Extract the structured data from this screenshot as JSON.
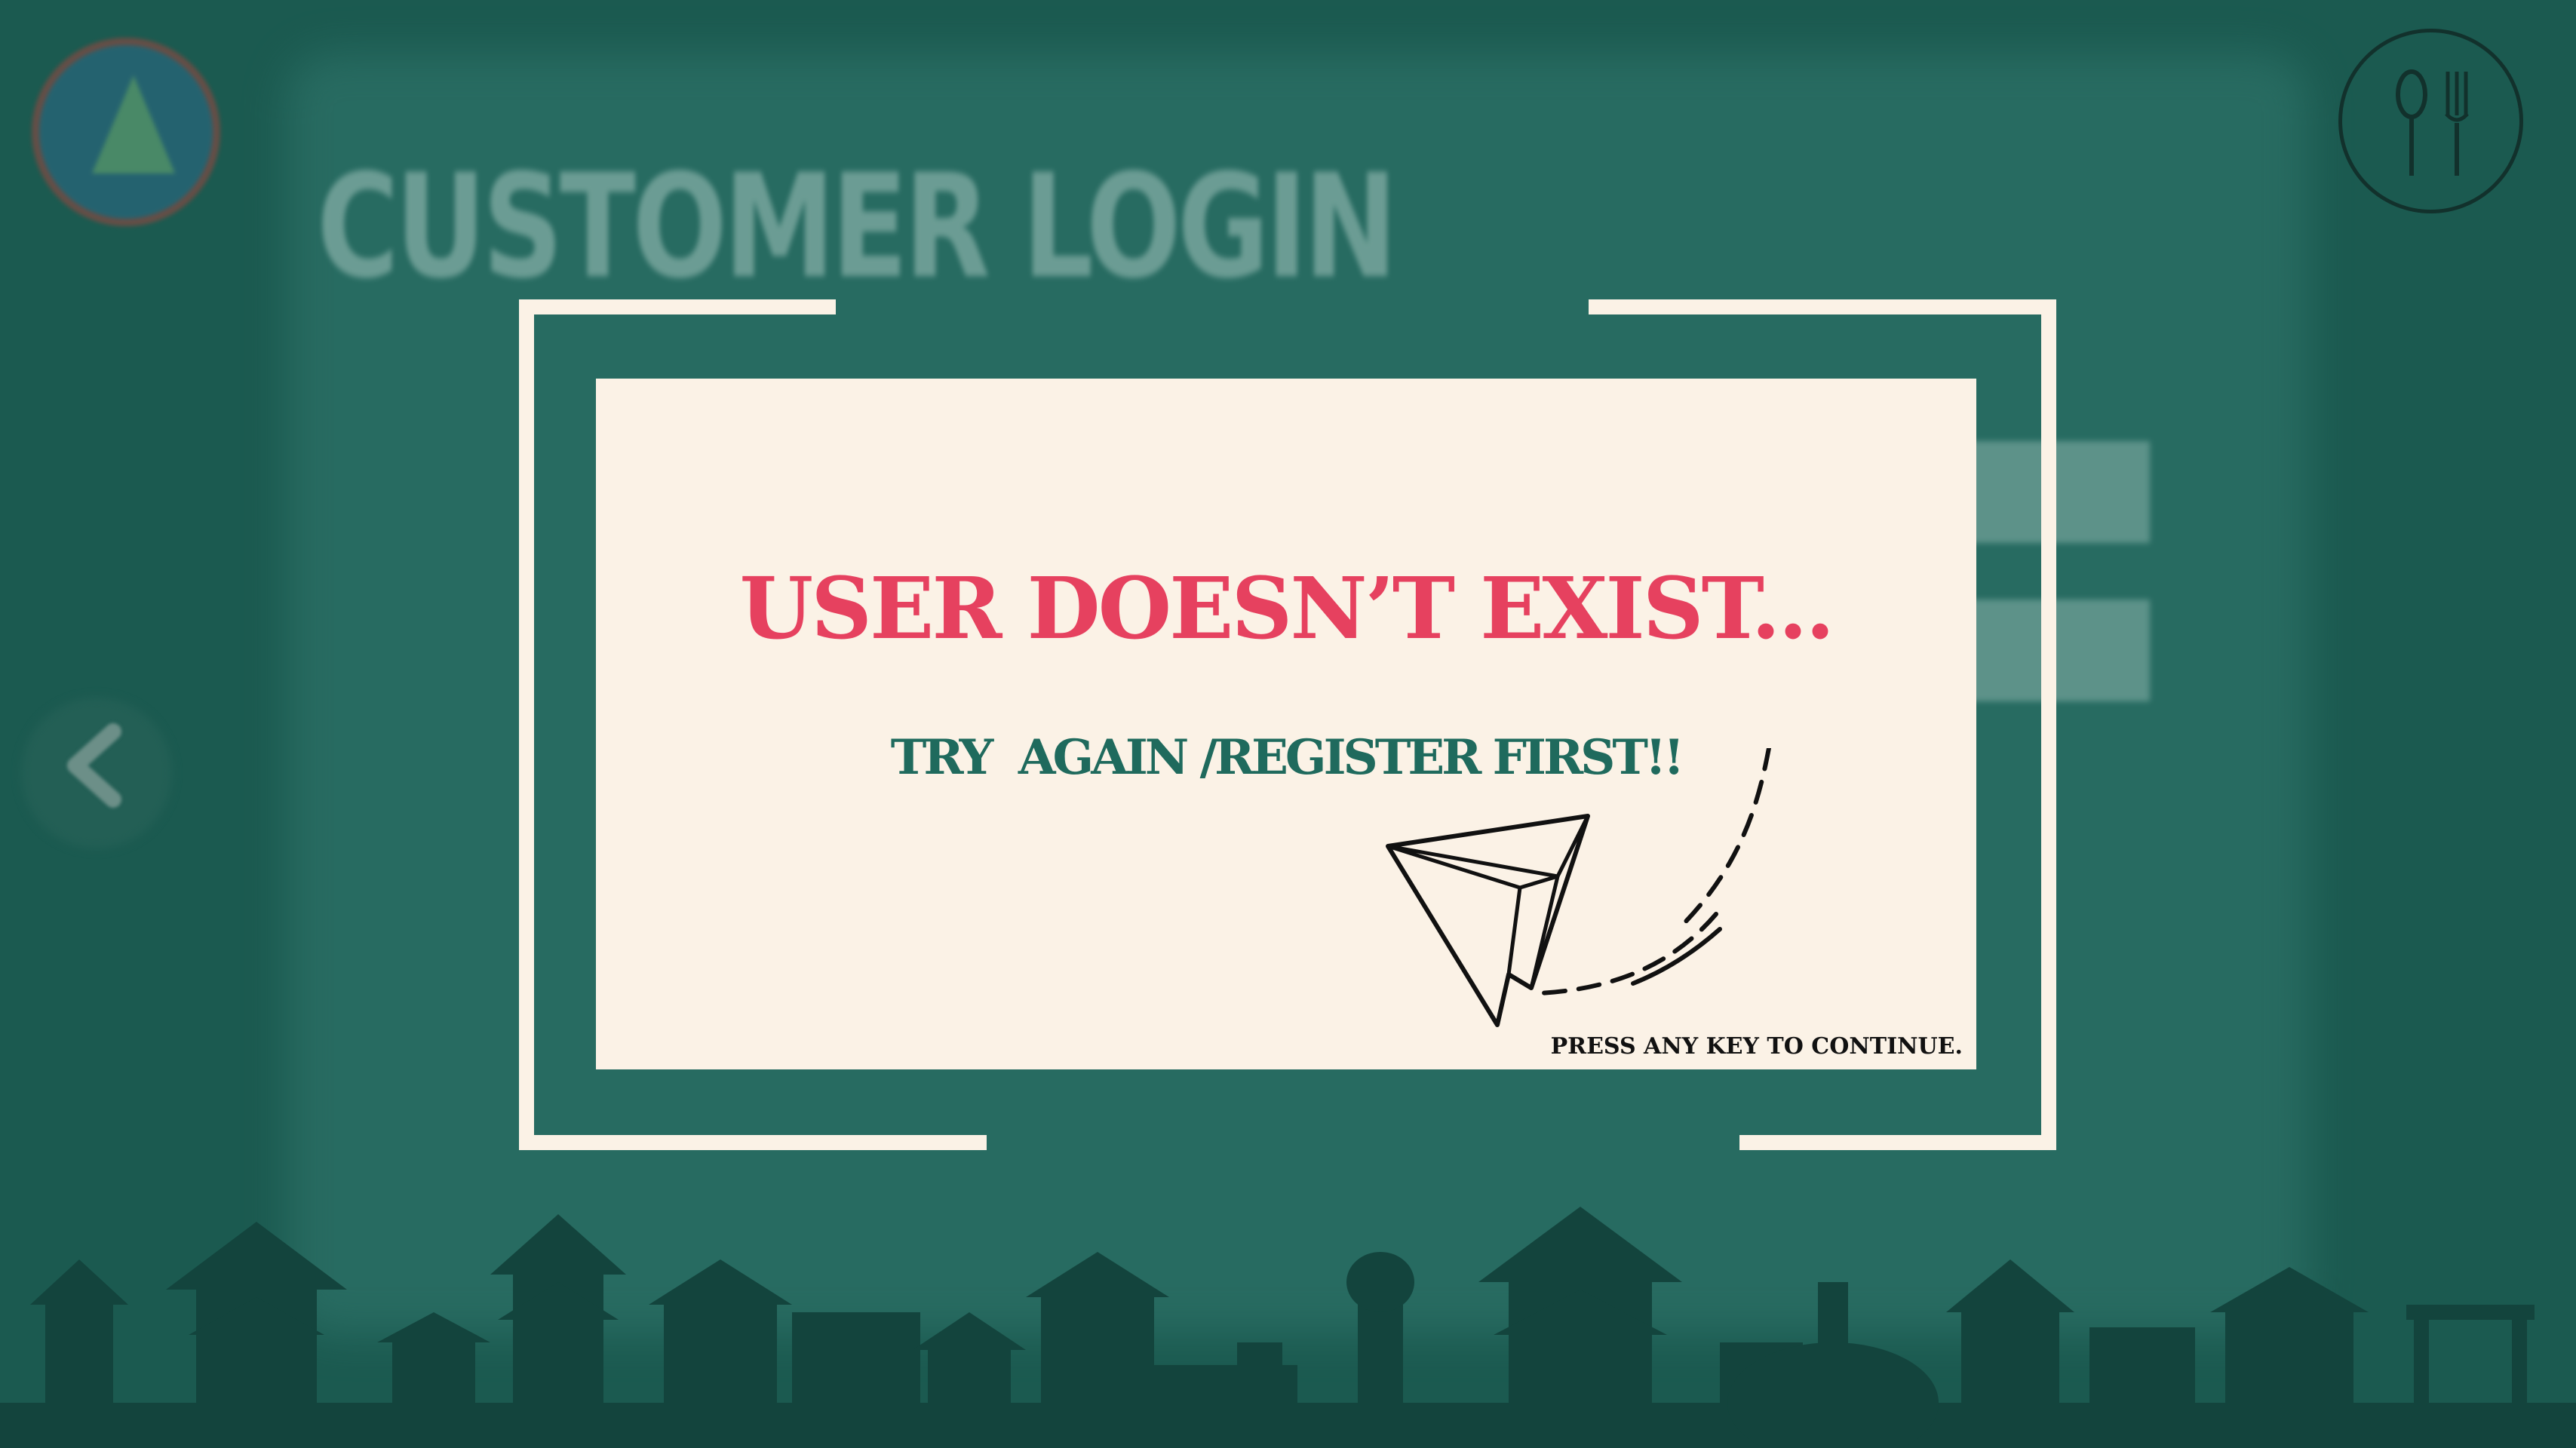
{
  "background": {
    "page_title": "CUSTOMER LOGIN",
    "logo_icon": "emblem-logo-icon",
    "menu_icon": "spoon-fork-icon",
    "back_icon": "chevron-left-icon"
  },
  "dialog": {
    "title": "USER DOESN’T EXIST...",
    "subtitle": "TRY  AGAIN /REGISTER FIRST!!",
    "hint": "PRESS ANY KEY TO CONTINUE.",
    "illustration_icon": "paper-plane-icon"
  },
  "colors": {
    "background": "#1b5a50",
    "dialog": "#fbf2e6",
    "title": "#e6415f",
    "subtitle": "#1f6a5d"
  }
}
